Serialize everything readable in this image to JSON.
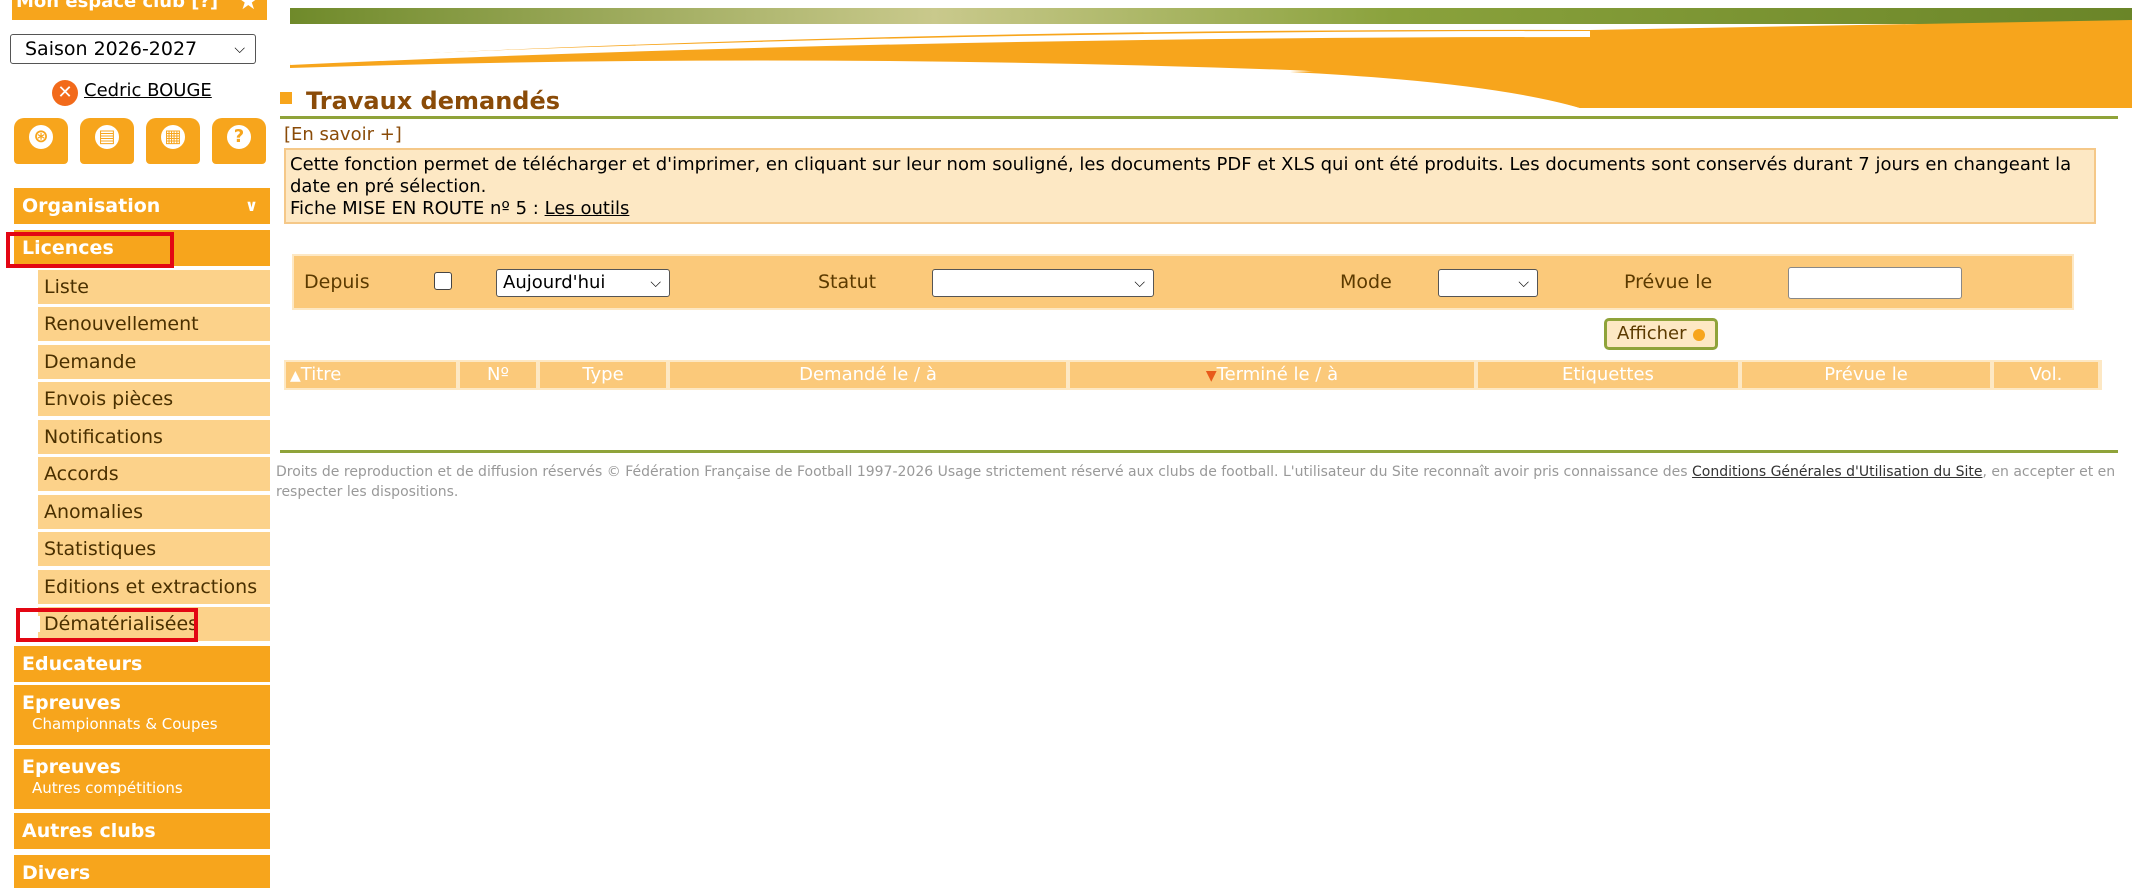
{
  "sidebar": {
    "espace_label": "Mon espace club [?]",
    "season_value": "Saison 2026-2027",
    "user_name": "Cedric BOUGE",
    "quick_icons": [
      "film-reel-icon",
      "document-icon",
      "calculator-icon",
      "help-icon"
    ],
    "organisation_label": "Organisation",
    "licences_label": "Licences",
    "licences_items": [
      "Liste",
      "Renouvellement",
      "Demande",
      "Envois pièces",
      "Notifications",
      "Accords",
      "Anomalies",
      "Statistiques",
      "Editions et extractions",
      "Dématérialisées"
    ],
    "other_menus": [
      {
        "label": "Educateurs",
        "sub": ""
      },
      {
        "label": "Epreuves",
        "sub": "Championnats & Coupes"
      },
      {
        "label": "Epreuves",
        "sub": "Autres compétitions"
      },
      {
        "label": "Autres clubs",
        "sub": ""
      },
      {
        "label": "Divers",
        "sub": ""
      }
    ]
  },
  "main": {
    "title": "Travaux demandés",
    "en_savoir": "[En savoir +]",
    "info_text": "Cette fonction permet de télécharger et d'imprimer, en cliquant sur leur nom souligné, les documents PDF et XLS qui ont été produits. Les documents sont conservés durant 7 jours en changeant la date en pré sélection.",
    "info_fiche_prefix": "Fiche MISE EN ROUTE nº 5 :",
    "info_fiche_link": "Les outils"
  },
  "filters": {
    "depuis_label": "Depuis",
    "depuis_value": "Aujourd'hui",
    "statut_label": "Statut",
    "statut_value": "",
    "mode_label": "Mode",
    "mode_value": "",
    "prevue_label": "Prévue le",
    "prevue_value": "",
    "afficher_label": "Afficher"
  },
  "table": {
    "columns": [
      "Titre",
      "Nº",
      "Type",
      "Demandé le / à",
      "Terminé le / à",
      "Etiquettes",
      "Prévue le",
      "Vol."
    ]
  },
  "footer": {
    "text_before": "Droits de reproduction et de diffusion réservés © Fédération Française de Football 1997-2026 Usage strictement réservé aux clubs de football. L'utilisateur du Site reconnaît avoir pris connaissance des ",
    "link": "Conditions Générales d'Utilisation du Site",
    "text_after": ", en accepter et en respecter les dispositions."
  },
  "colors": {
    "orange": "#f7a51c",
    "light_orange": "#fcd28a",
    "cream": "#fde8c4",
    "olive": "#8fa33a",
    "brown": "#8a4b08",
    "highlight_red": "#e30613"
  }
}
